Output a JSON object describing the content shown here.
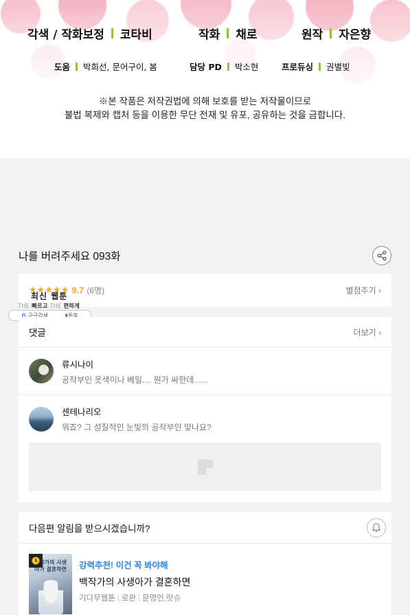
{
  "credits": {
    "row1": [
      {
        "role": "각색 / 작화보정",
        "name": "코타비"
      },
      {
        "role": "작화",
        "name": "채로"
      },
      {
        "role": "원작",
        "name": "자은향"
      }
    ],
    "row2": [
      {
        "role": "도움",
        "name": "박희선, 문어구이, 봄"
      },
      {
        "role": "담당 PD",
        "name": "박소현"
      },
      {
        "role": "프로듀싱",
        "name": "권별빛"
      }
    ],
    "notice_line1": "※본 작품은 저작권법에 의해 보호를 받는 저작물이므로",
    "notice_line2": "불법 복제와 캡처 등을 이용한 무단 전재 및 유포, 공유하는 것을 금합니다."
  },
  "episode": {
    "title": "나를 버려주세요 093화",
    "share_icon": "share-icon"
  },
  "rating": {
    "stars": "★★★★★",
    "score": "9.7",
    "count": "(6명)",
    "rate_link": "별점주기 ›"
  },
  "overlay_ad": {
    "title": "최신 웹툰",
    "sub_prefix": "THE",
    "sub_a": "빠르고",
    "sub_b": "편하게",
    "pill_left": "구글검색",
    "pill_right": "툰북"
  },
  "comments": {
    "header": "댓글",
    "more_link": "더보기 ›",
    "items": [
      {
        "name": "류시나이",
        "text": "공작부인 옷색이나 베일.... 뭔가 싸한데......"
      },
      {
        "name": "센테나리오",
        "text": "뭐죠? 그 성질적인 눈빛의 공작부인 맞나요?"
      }
    ]
  },
  "notify": {
    "question": "다음편 알림을 받으시겠습니까?",
    "bell_icon": "bell-icon"
  },
  "recommend": {
    "tag": "강력추천! 이건 꼭 봐야해",
    "title": "백작가의 사생아가 결혼하면",
    "meta": [
      "기다무웹툰",
      "로판",
      "문명인,랏슈"
    ],
    "thumb_text": "백작가의 사생아가 결혼하면"
  },
  "colors": {
    "accent_green": "#8cc63f",
    "star_orange": "#f5a623",
    "tag_blue": "#2f86e0"
  }
}
